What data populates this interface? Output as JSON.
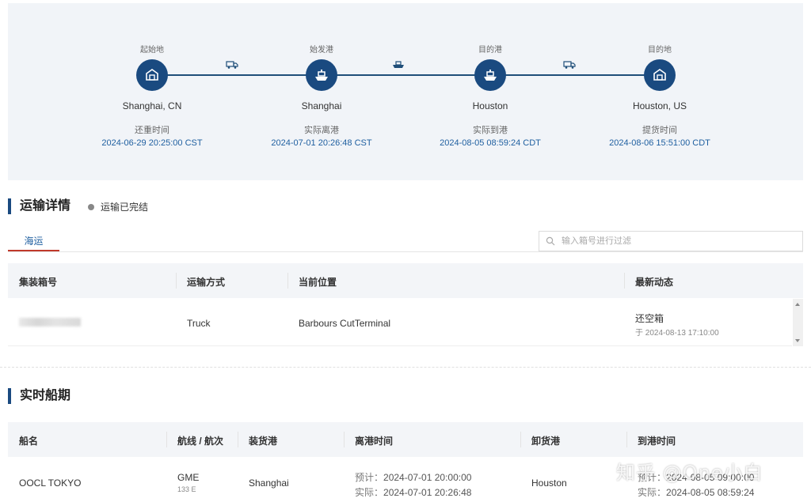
{
  "route": {
    "nodes": [
      {
        "type": "起始地",
        "place": "Shanghai, CN",
        "event": "还重时间",
        "time": "2024-06-29 20:25:00 CST",
        "icon": "warehouse-icon"
      },
      {
        "type": "始发港",
        "place": "Shanghai",
        "event": "实际离港",
        "time": "2024-07-01 20:26:48 CST",
        "icon": "ship-icon"
      },
      {
        "type": "目的港",
        "place": "Houston",
        "event": "实际到港",
        "time": "2024-08-05 08:59:24 CDT",
        "icon": "ship-icon"
      },
      {
        "type": "目的地",
        "place": "Houston, US",
        "event": "提货时间",
        "time": "2024-08-06 15:51:00 CDT",
        "icon": "warehouse-icon"
      }
    ],
    "legs": [
      "truck-icon",
      "vessel-icon",
      "truck-icon"
    ]
  },
  "transport": {
    "title": "运输详情",
    "status": "运输已完结",
    "tab": "海运",
    "search_placeholder": "输入箱号进行过滤",
    "columns": [
      "集装箱号",
      "运输方式",
      "当前位置",
      "最新动态"
    ],
    "rows": [
      {
        "mode": "Truck",
        "location": "Barbours CutTerminal",
        "latest": "还空箱",
        "latest_time": "于 2024-08-13 17:10:00"
      }
    ]
  },
  "schedule": {
    "title": "实时船期",
    "columns": [
      "船名",
      "航线 / 航次",
      "装货港",
      "离港时间",
      "卸货港",
      "到港时间"
    ],
    "rows": [
      {
        "vessel": "OOCL TOKYO",
        "route": "GME",
        "voyage": "133 E",
        "load_port": "Shanghai",
        "dep_est_label": "预计：",
        "dep_est": "2024-07-01 20:00:00",
        "dep_act_label": "实际：",
        "dep_act": "2024-07-01 20:26:48",
        "discharge_port": "Houston",
        "arr_est_label": "预计：",
        "arr_est": "2024-08-05 09:00:00",
        "arr_act_label": "实际：",
        "arr_act": "2024-08-05 08:59:24"
      }
    ]
  },
  "watermark": "知乎 @One小白",
  "colors": {
    "primary": "#1a4a80",
    "link": "#1f5fa0",
    "tab_underline": "#c0392b",
    "panel_bg": "#f1f4f8"
  }
}
